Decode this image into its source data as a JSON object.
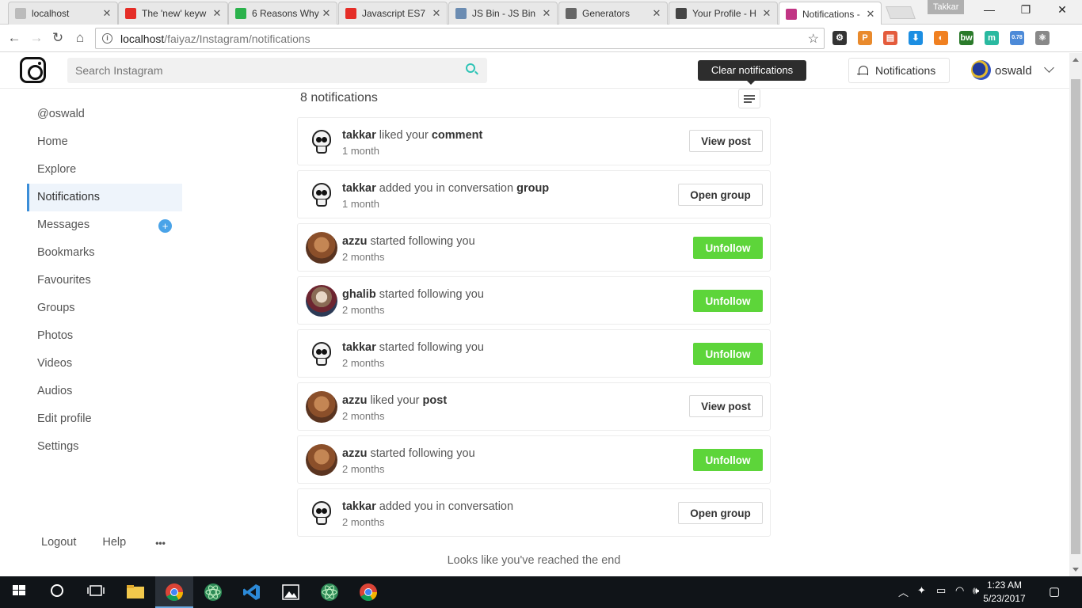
{
  "browser": {
    "tabs": [
      {
        "title": "localhost",
        "favicon": "page-icon",
        "color": "#bbbbbb"
      },
      {
        "title": "The 'new' keyw",
        "favicon": "youtube-icon",
        "color": "#e52d27"
      },
      {
        "title": "6 Reasons Why",
        "favicon": "timer-icon",
        "color": "#2bb24c"
      },
      {
        "title": "Javascript ES7",
        "favicon": "youtube-icon",
        "color": "#e52d27"
      },
      {
        "title": "JS Bin - JS Bin",
        "favicon": "jsbin-icon",
        "color": "#6b8cb2"
      },
      {
        "title": "Generators",
        "favicon": "codepen-icon",
        "color": "#666666"
      },
      {
        "title": "Your Profile - H",
        "favicon": "hashnode-icon",
        "color": "#444444"
      },
      {
        "title": "Notifications -",
        "favicon": "instagram-icon",
        "color": "#c13584"
      }
    ],
    "profile_name": "Takkar",
    "url_host": "localhost",
    "url_path": "/faiyaz/Instagram/notifications",
    "extensions": [
      {
        "label": "⚙",
        "color": "#333333"
      },
      {
        "label": "P",
        "color": "#e98a2c"
      },
      {
        "label": "▤",
        "color": "#e45b3c"
      },
      {
        "label": "⬇",
        "color": "#1c8ee2"
      },
      {
        "label": "◐",
        "color": "#f08020"
      },
      {
        "label": "bw",
        "color": "#2a7a2a"
      },
      {
        "label": "m",
        "color": "#29b9a0"
      },
      {
        "label": "0.78",
        "color": "#4c8ad8"
      },
      {
        "label": "⚛",
        "color": "#888888"
      }
    ]
  },
  "header": {
    "search_placeholder": "Search Instagram",
    "tooltip": "Clear notifications",
    "notifications_label": "Notifications",
    "username": "oswald"
  },
  "sidebar": {
    "items": [
      "@oswald",
      "Home",
      "Explore",
      "Notifications",
      "Messages",
      "Bookmarks",
      "Favourites",
      "Groups",
      "Photos",
      "Videos",
      "Audios",
      "Edit profile",
      "Settings"
    ],
    "active": "Notifications",
    "messages_badge": "+",
    "footer": {
      "logout": "Logout",
      "help": "Help",
      "more": "•••"
    }
  },
  "main": {
    "count_text": "8 notifications",
    "notifications": [
      {
        "user": "takkar",
        "action": "liked your",
        "object": "comment",
        "time": "1 month",
        "avatar": "skull",
        "button": "View post",
        "style": "light"
      },
      {
        "user": "takkar",
        "action": "added you in conversation",
        "object": "group",
        "time": "1 month",
        "avatar": "skull",
        "button": "Open group",
        "style": "light"
      },
      {
        "user": "azzu",
        "action": "started following you",
        "object": "",
        "time": "2 months",
        "avatar": "azzu",
        "button": "Unfollow",
        "style": "green"
      },
      {
        "user": "ghalib",
        "action": "started following you",
        "object": "",
        "time": "2 months",
        "avatar": "ghalib",
        "button": "Unfollow",
        "style": "green"
      },
      {
        "user": "takkar",
        "action": "started following you",
        "object": "",
        "time": "2 months",
        "avatar": "skull",
        "button": "Unfollow",
        "style": "green"
      },
      {
        "user": "azzu",
        "action": "liked your",
        "object": "post",
        "time": "2 months",
        "avatar": "azzu",
        "button": "View post",
        "style": "light"
      },
      {
        "user": "azzu",
        "action": "started following you",
        "object": "",
        "time": "2 months",
        "avatar": "azzu",
        "button": "Unfollow",
        "style": "green"
      },
      {
        "user": "takkar",
        "action": "added you in conversation",
        "object": "",
        "time": "2 months",
        "avatar": "skull",
        "button": "Open group",
        "style": "light"
      }
    ],
    "end_text": "Looks like you've reached the end"
  },
  "taskbar": {
    "time": "1:23 AM",
    "date": "5/23/2017"
  }
}
